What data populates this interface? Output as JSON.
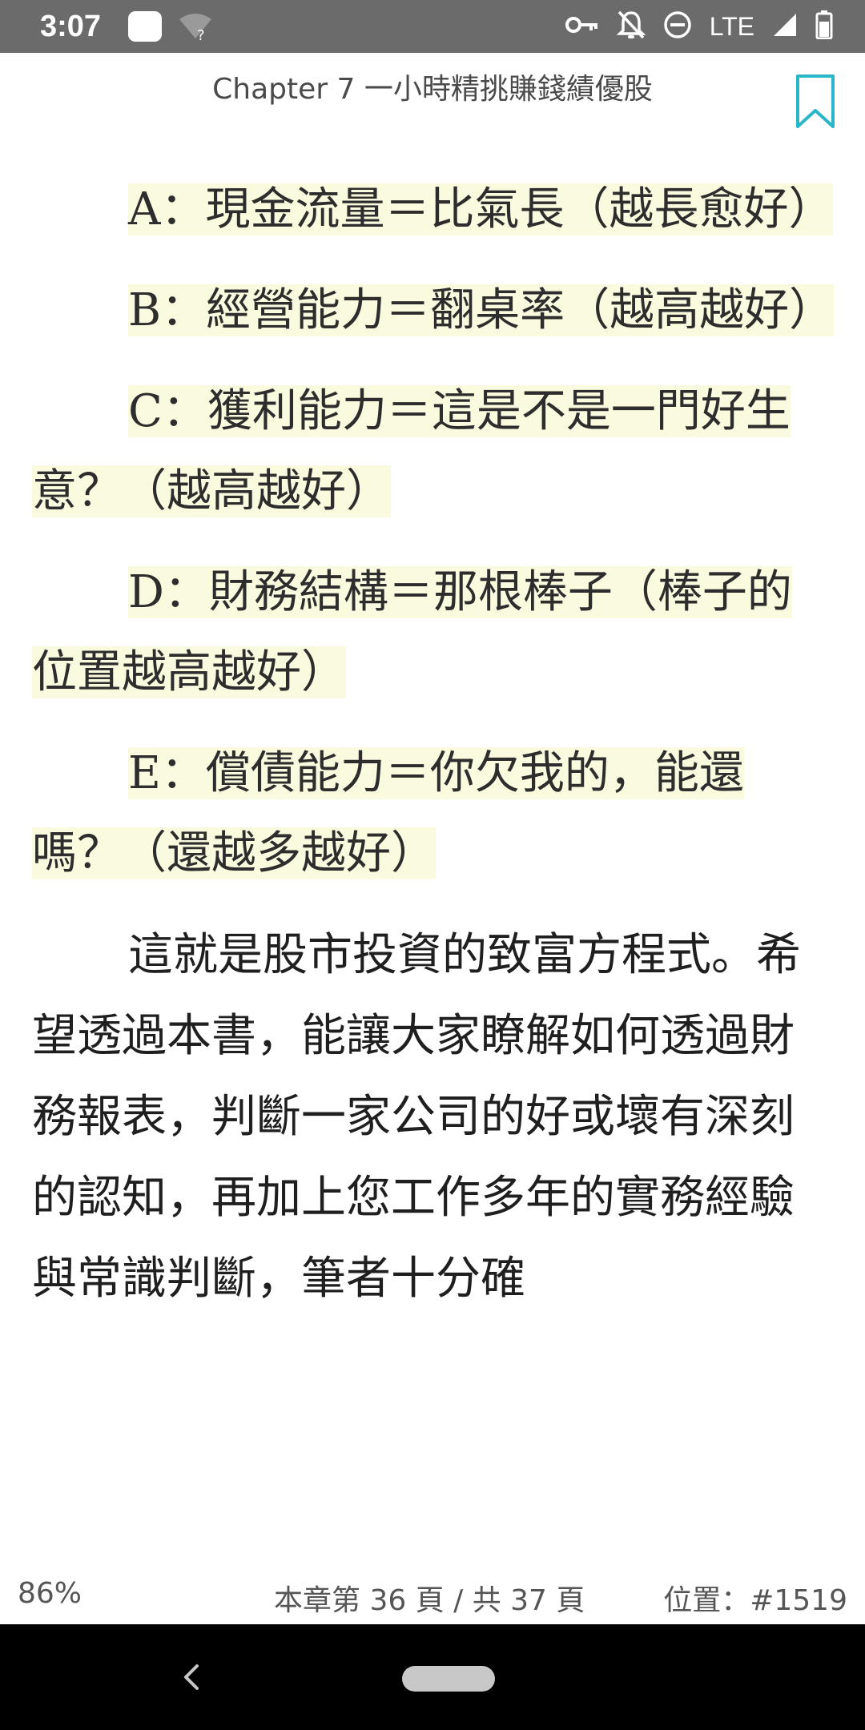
{
  "status_bar": {
    "time": "3:07",
    "network_label": "LTE",
    "icons": [
      "notification-square-icon",
      "wifi-question-icon",
      "vpn-key-icon",
      "bell-off-icon",
      "do-not-disturb-icon",
      "signal-icon",
      "battery-icon"
    ]
  },
  "header": {
    "chapter_title": "Chapter 7 一小時精挑賺錢績優股",
    "bookmark_icon": "bookmark-icon",
    "accent_color": "#29b6c8"
  },
  "content": {
    "highlight_color": "#fafadf",
    "items": [
      "A：現金流量＝比氣長（越長愈好）",
      "B：經營能力＝翻桌率（越高越好）",
      "C：獲利能力＝這是不是一門好生意？（越高越好）",
      "D：財務結構＝那根棒子（棒子的位置越高越好）",
      "E：償債能力＝你欠我的，能還嗎？（還越多越好）"
    ],
    "body": "這就是股市投資的致富方程式。希望透過本書，能讓大家瞭解如何透過財務報表，判斷一家公司的好或壞有深刻的認知，再加上您工作多年的實務經驗與常識判斷，筆者十分確"
  },
  "footer": {
    "progress_text": "86%",
    "progress": 0.86,
    "page_text": "本章第 36 頁 / 共 37 頁",
    "location_text": "位置：#1519"
  },
  "nav_bar": {
    "back_icon": "back-chevron-icon",
    "home_icon": "home-pill-icon"
  }
}
